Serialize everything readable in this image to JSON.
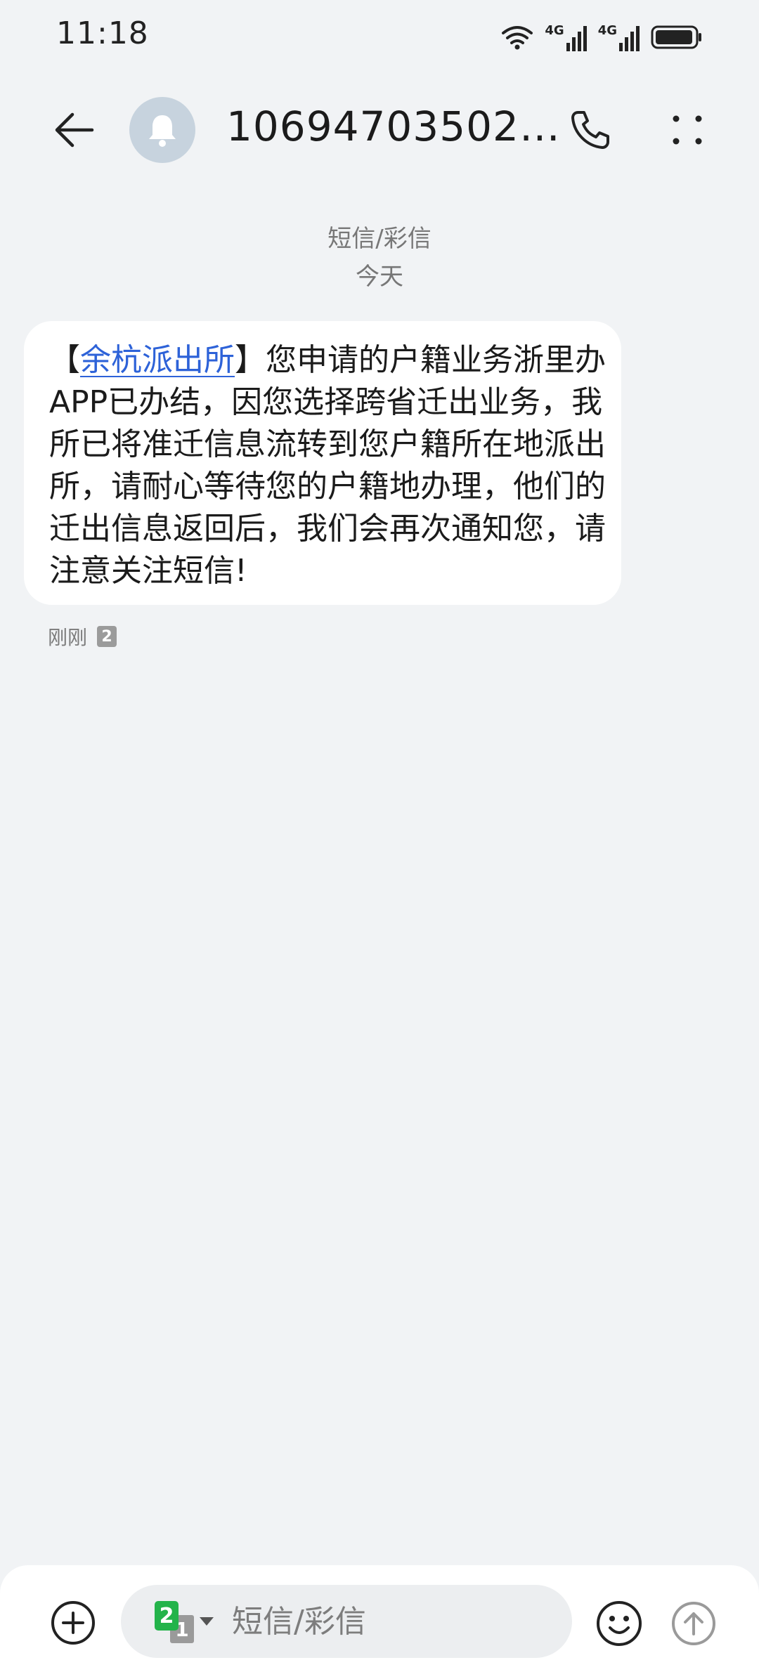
{
  "status_bar": {
    "time": "11:18",
    "sim1_label": "4G",
    "sim2_label": "4G"
  },
  "header": {
    "contact": "10694703502…",
    "icons": [
      "back-arrow-icon",
      "bell-icon",
      "phone-icon",
      "more-vertical-icon"
    ]
  },
  "conversation": {
    "type_label": "短信/彩信",
    "date_label": "今天"
  },
  "message": {
    "bracket_open": "【",
    "sender": "余杭派出所",
    "bracket_close": "】",
    "body": "您申请的户籍业务浙里办APP已办结，因您选择跨省迁出业务，我所已将准迁信息流转到您户籍所在地派出所，请耐心等待您的户籍地办理，他们的迁出信息返回后，我们会再次通知您，请注意关注短信!",
    "time": "刚刚",
    "sim_badge": "2"
  },
  "composer": {
    "sim_front": "2",
    "sim_back": "1",
    "placeholder": "短信/彩信",
    "icons": [
      "add-icon",
      "sim-switch-icon",
      "emoji-icon",
      "send-icon"
    ]
  },
  "colors": {
    "background": "#f1f3f5",
    "link": "#2d62d8",
    "sim_green": "#23b34a"
  }
}
